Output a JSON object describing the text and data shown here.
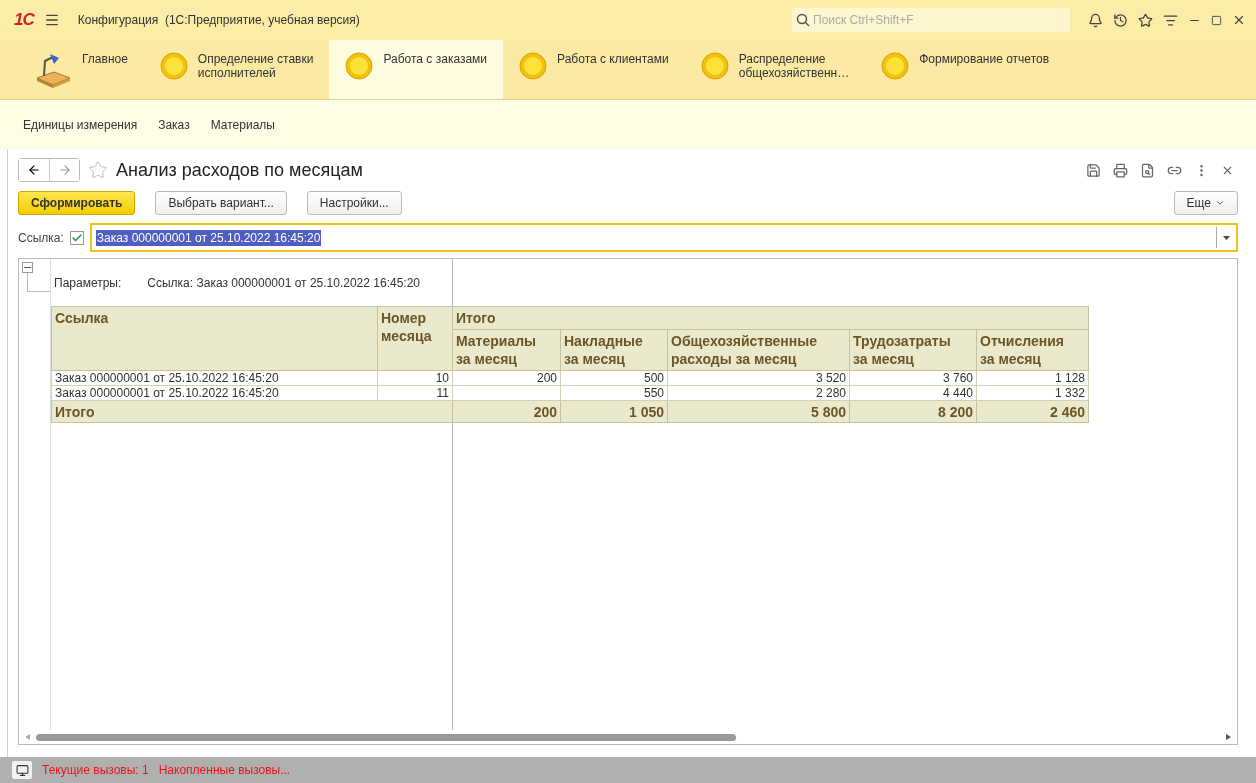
{
  "window": {
    "logo": "1С",
    "title": "Конфигурация  (1С:Предприятие, учебная версия)",
    "search_placeholder": "Поиск Ctrl+Shift+F"
  },
  "sections": [
    {
      "label": "Главное",
      "kind": "home",
      "selected": false
    },
    {
      "label": "Определение ставки\nисполнителей",
      "kind": "section",
      "selected": false
    },
    {
      "label": "Работа с заказами",
      "kind": "section",
      "selected": true
    },
    {
      "label": "Работа с клиентами",
      "kind": "section",
      "selected": false
    },
    {
      "label": "Распределение\nобщехозяйственн…",
      "kind": "section",
      "selected": false
    },
    {
      "label": "Формирование отчетов",
      "kind": "section",
      "selected": false
    }
  ],
  "subsections": [
    "Единицы измерения",
    "Заказ",
    "Материалы"
  ],
  "form": {
    "title": "Анализ расходов по месяцам",
    "favorite": false,
    "buttons": [
      {
        "label": "Сформировать",
        "kind": "primary"
      },
      {
        "label": "Выбрать вариант...",
        "kind": "normal"
      },
      {
        "label": "Настройки...",
        "kind": "normal"
      }
    ],
    "more_button": "Еще",
    "filter": {
      "label": "Ссылка:",
      "checked": true,
      "value": "Заказ 000000001 от 25.10.2022 16:45:20",
      "value_selected": true
    }
  },
  "report": {
    "group_expanded": true,
    "parameters_label": "Параметры:",
    "parameters_value": "Ссылка: Заказ 000000001 от 25.10.2022 16:45:20",
    "table": {
      "group_header": "Итого",
      "key_columns": [
        "Ссылка",
        "Номер\nмесяца"
      ],
      "value_columns": [
        "Материалы\nза месяц",
        "Накладные\nза месяц",
        "Общехозяйственные\nрасходы за месяц",
        "Трудозатраты\nза месяц",
        "Отчисления\nза месяц"
      ],
      "rows": [
        {
          "cells": [
            "Заказ 000000001 от 25.10.2022 16:45:20",
            "10",
            "200",
            "500",
            "3 520",
            "3 760",
            "1 128"
          ]
        },
        {
          "cells": [
            "Заказ 000000001 от 25.10.2022 16:45:20",
            "11",
            "",
            "550",
            "2 280",
            "4 440",
            "1 332"
          ]
        }
      ],
      "total": {
        "label": "Итого",
        "values": [
          "200",
          "1 050",
          "5 800",
          "8 200",
          "2 460"
        ]
      }
    }
  },
  "status_bar": {
    "current_calls": "Текущие вызовы: 1",
    "accumulated_calls": "Накопленные вызовы..."
  }
}
